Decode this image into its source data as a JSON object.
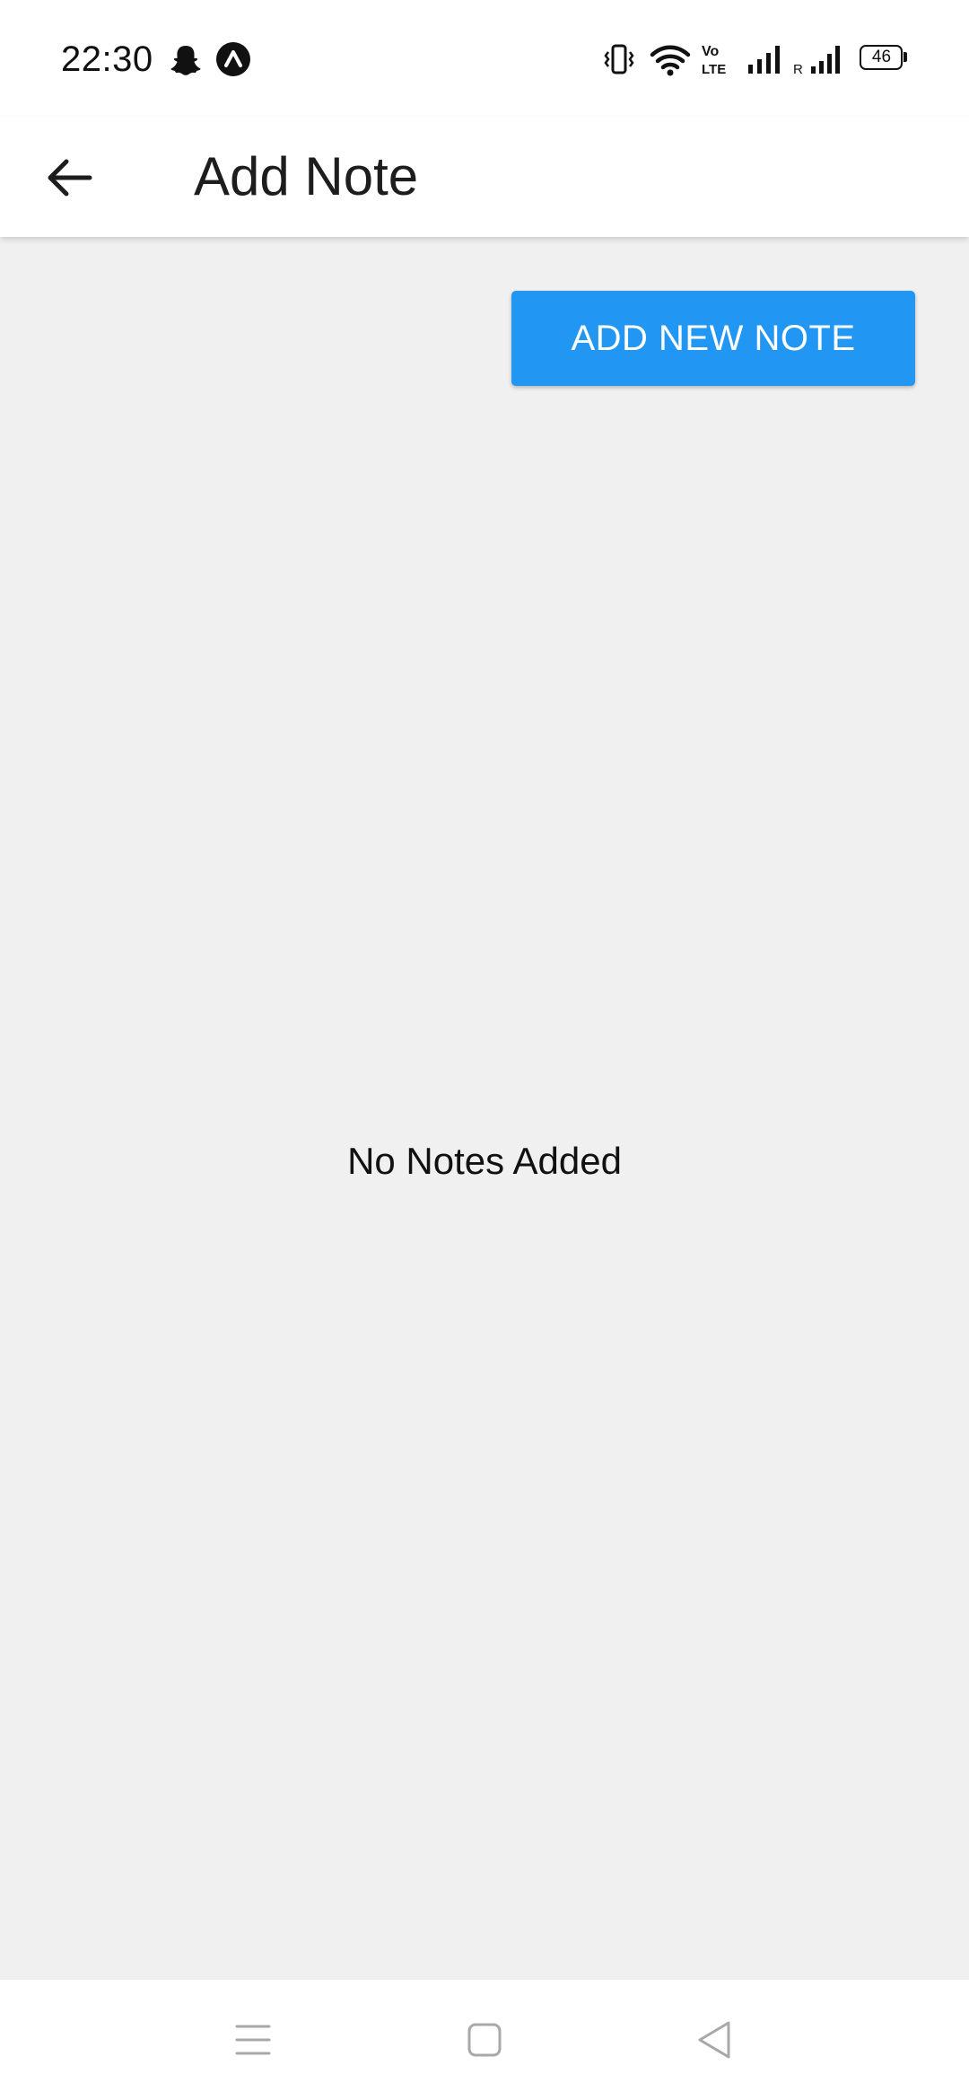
{
  "status_bar": {
    "time": "22:30",
    "notification_icons": [
      "snapchat-icon",
      "expo-icon"
    ],
    "system_icons": [
      "vibrate-icon",
      "wifi-icon",
      "volte-icon",
      "signal-icon",
      "roaming-signal-icon",
      "battery-icon"
    ],
    "roaming_label": "R",
    "volte_label_top": "Vo",
    "volte_label_bottom": "LTE",
    "battery_level": "46"
  },
  "app_bar": {
    "title": "Add Note",
    "back_icon": "arrow-back-icon"
  },
  "main": {
    "add_button_label": "ADD NEW NOTE",
    "empty_message": "No Notes Added"
  },
  "nav_bar": {
    "icons": [
      "menu-icon",
      "home-square-icon",
      "back-triangle-icon"
    ]
  },
  "colors": {
    "accent": "#2196f3",
    "background": "#f0f0f0",
    "surface": "#ffffff"
  }
}
